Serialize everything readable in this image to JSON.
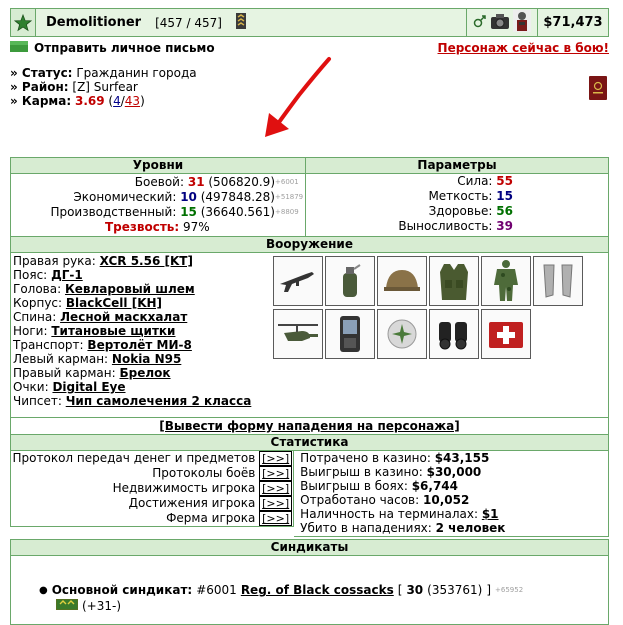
{
  "header": {
    "username": "Demolitioner",
    "hp": "[457 / 457]",
    "money": "$71,473"
  },
  "message_bar": {
    "send_message": "Отправить личное письмо",
    "character_in_battle": "Персонаж сейчас в бою!"
  },
  "info": {
    "status_label": "» Статус:",
    "status_value": "Гражданин города",
    "district_label": "» Район:",
    "district_value": "[Z] Surfear",
    "karma_label": "» Карма:",
    "karma_value": "3.69",
    "karma_open": "(",
    "karma_pos": "4",
    "karma_sep": "/",
    "karma_neg": "43",
    "karma_close": ")"
  },
  "levels": {
    "title": "Уровни",
    "combat_label": "Боевой:",
    "combat_level": "31",
    "combat_exp": "(506820.9)",
    "combat_next": "+6001",
    "econ_label": "Экономический:",
    "econ_level": "10",
    "econ_exp": "(497848.28)",
    "econ_next": "+51879",
    "prod_label": "Производственный:",
    "prod_level": "15",
    "prod_exp": "(36640.561)",
    "prod_next": "+8809",
    "sobriety_label": "Трезвость:",
    "sobriety_value": "97%"
  },
  "params": {
    "title": "Параметры",
    "strength_label": "Сила:",
    "strength": "55",
    "accuracy_label": "Меткость:",
    "accuracy": "15",
    "health_label": "Здоровье:",
    "health": "56",
    "endurance_label": "Выносливость:",
    "endurance": "39"
  },
  "armament": {
    "title": "Вооружение",
    "rows": [
      {
        "label": "Правая рука:",
        "value": "XCR 5.56 [KT]"
      },
      {
        "label": "Пояс:",
        "value": "ДГ-1"
      },
      {
        "label": "Голова:",
        "value": "Кевларовый шлем"
      },
      {
        "label": "Корпус:",
        "value": "BlackCell [KH]"
      },
      {
        "label": "Спина:",
        "value": "Лесной маскхалат"
      },
      {
        "label": "Ноги:",
        "value": "Титановые щитки"
      },
      {
        "label": "Транспорт:",
        "value": "Вертолёт МИ-8"
      },
      {
        "label": "Левый карман:",
        "value": "Nokia N95"
      },
      {
        "label": "Правый карман:",
        "value": "Брелок"
      },
      {
        "label": "Очки:",
        "value": "Digital Eye"
      },
      {
        "label": "Чипсет:",
        "value": "Чип самолечения 2 класса"
      }
    ],
    "attack_form": "[Вывести форму нападения на персонажа]"
  },
  "stats": {
    "title": "Статистика",
    "links": [
      {
        "label": "Протокол передач денег и предметов",
        "btn": "[>>]"
      },
      {
        "label": "Протоколы боёв",
        "btn": "[>>]"
      },
      {
        "label": "Недвижимость игрока",
        "btn": "[>>]"
      },
      {
        "label": "Достижения игрока",
        "btn": "[>>]"
      },
      {
        "label": "Ферма игрока",
        "btn": "[>>]"
      }
    ],
    "casino_spent_label": "Потрачено в казино:",
    "casino_spent": "$43,155",
    "casino_won_label": "Выигрыш в казино:",
    "casino_won": "$30,000",
    "battle_won_label": "Выигрыш в боях:",
    "battle_won": "$6,744",
    "hours_label": "Отработано часов:",
    "hours": "10,052",
    "terminal_label": "Наличность на терминалах:",
    "terminal": "$1",
    "killed_label": "Убито в нападениях:",
    "killed": "2 человек"
  },
  "syndicates": {
    "title": "Синдикаты",
    "main_label": "Основной синдикат:",
    "number": "#6001",
    "name": "Reg. of Black cossacks",
    "open": "[",
    "level": "30",
    "exp": "(353761)",
    "close": "]",
    "next": "+65952",
    "rank": "(+31-)"
  },
  "colors": {
    "border": "#6aa86a",
    "header_bg": "#e6f4e2",
    "title_bg": "#d7ecd2",
    "accent_red": "#c00000"
  }
}
